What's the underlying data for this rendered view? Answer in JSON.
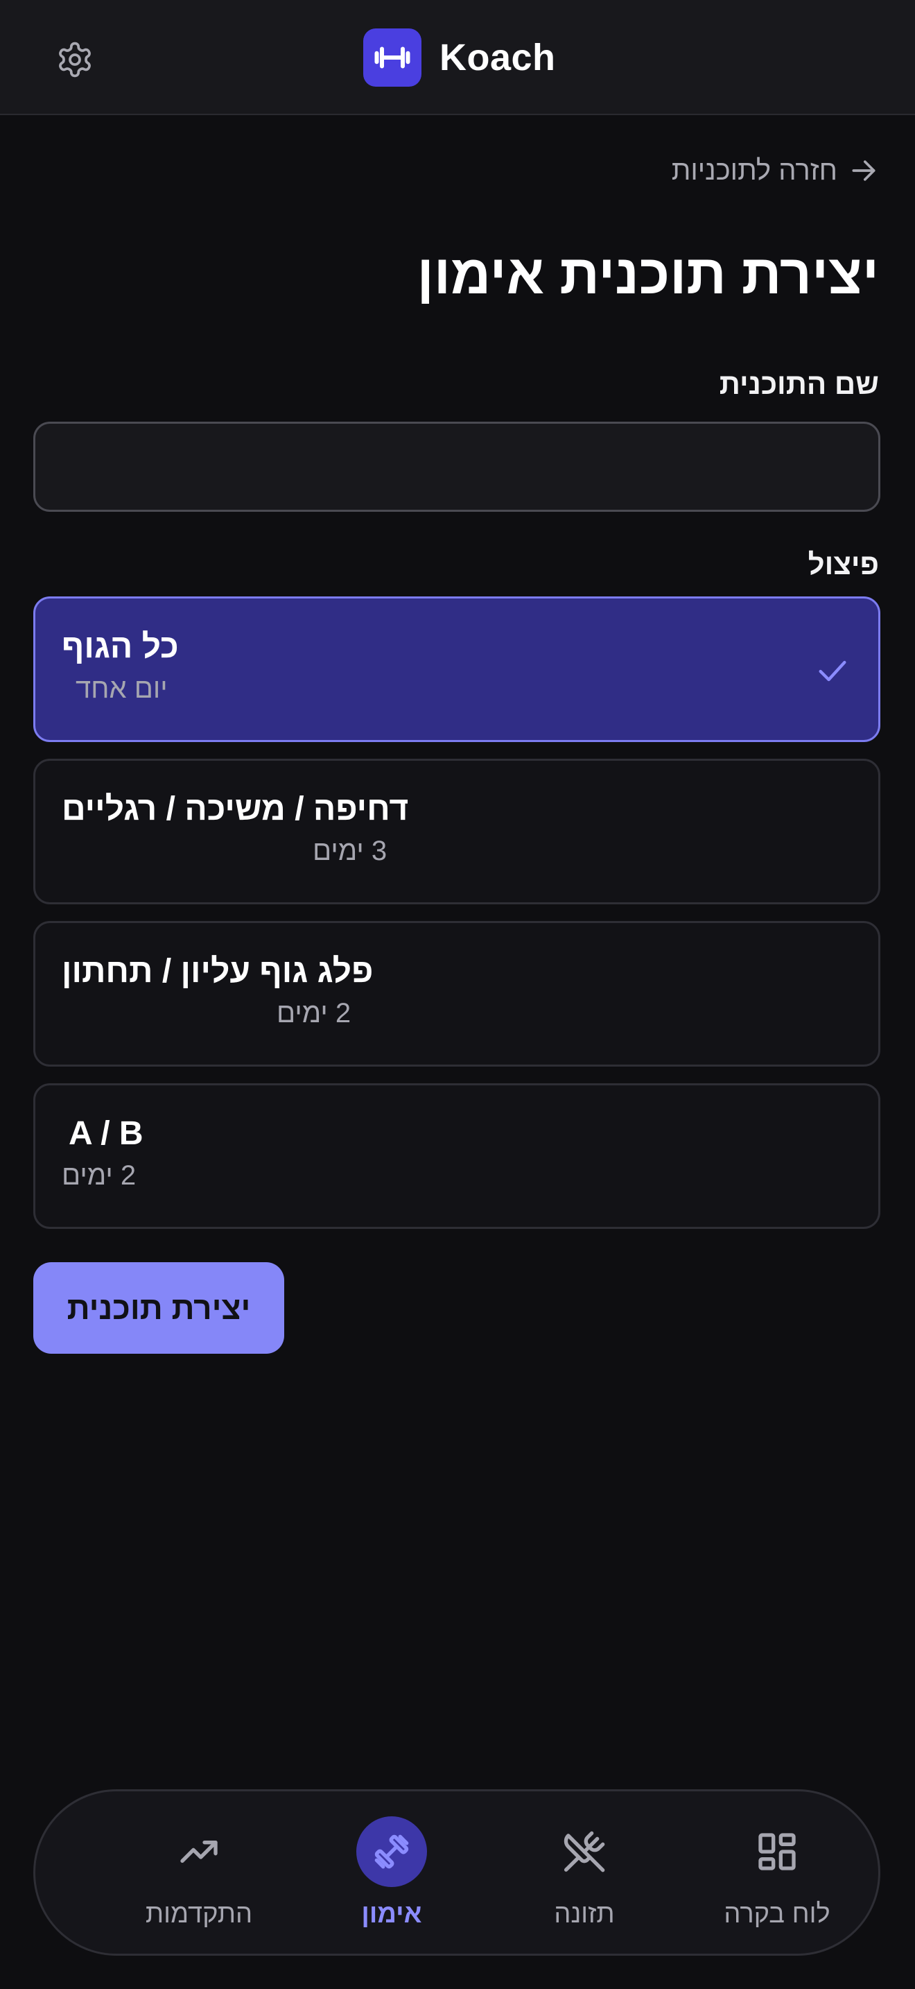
{
  "header": {
    "app_name": "Koach",
    "settings_icon": "gear-icon",
    "logo_icon": "dumbbell-icon"
  },
  "back_link": {
    "label": "חזרה לתוכניות",
    "icon": "arrow-right-icon"
  },
  "page_title": "יצירת תוכנית אימון",
  "plan_name": {
    "label": "שם התוכנית",
    "value": "",
    "placeholder": ""
  },
  "split": {
    "label": "פיצול",
    "options": [
      {
        "title": "כל הגוף",
        "subtitle": "יום אחד",
        "selected": true
      },
      {
        "title": "דחיפה / משיכה / רגליים",
        "subtitle": "3 ימים",
        "selected": false
      },
      {
        "title": "פלג גוף עליון / תחתון",
        "subtitle": "2 ימים",
        "selected": false
      },
      {
        "title": "A / B",
        "subtitle": "2 ימים",
        "selected": false
      }
    ]
  },
  "create_button": "יצירת תוכנית",
  "bottom_nav": {
    "items": [
      {
        "label": "התקדמות",
        "icon": "trending-up-icon",
        "active": false
      },
      {
        "label": "אימון",
        "icon": "dumbbell-icon",
        "active": true
      },
      {
        "label": "תזונה",
        "icon": "utensils-crossed-icon",
        "active": false
      },
      {
        "label": "לוח בקרה",
        "icon": "dashboard-grid-icon",
        "active": false
      }
    ]
  },
  "colors": {
    "background": "#0e0e11",
    "accent": "#8587f8",
    "selected_card": "#302d86",
    "logo": "#4a3fe0"
  }
}
